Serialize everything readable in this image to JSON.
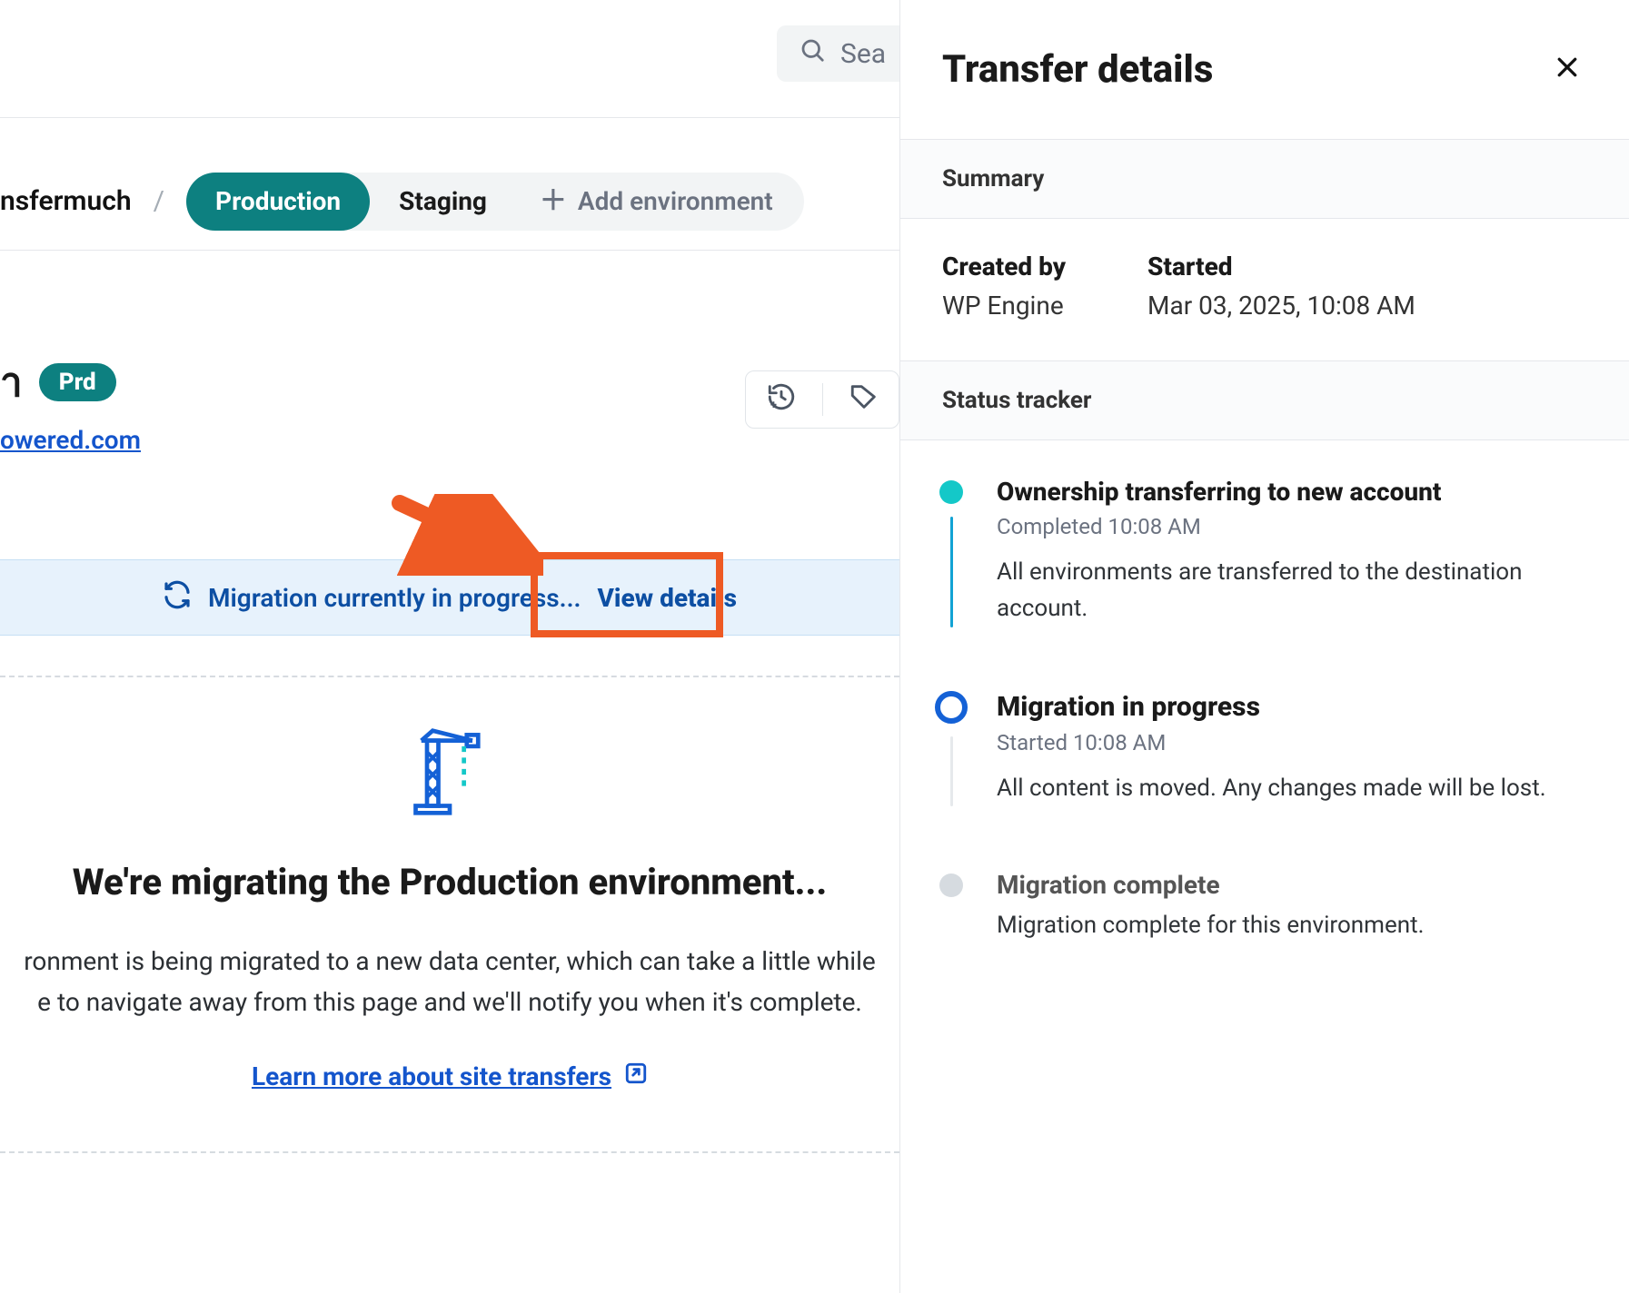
{
  "search": {
    "placeholder": "Sea"
  },
  "breadcrumb": {
    "site_fragment": "nsfermuch",
    "slash": "/"
  },
  "envs": {
    "production": "Production",
    "staging": "Staging",
    "add_label": "Add environment"
  },
  "header": {
    "name_fragment": "า",
    "prd_badge": "Prd",
    "domain_fragment": "owered.com"
  },
  "banner": {
    "message": "Migration currently in progress...",
    "cta": "View details"
  },
  "migration_card": {
    "title": "We're migrating the Production environment...",
    "body_line1": "ronment is being migrated to a new data center, which can take a little while",
    "body_line2": "e to navigate away from this page and we'll notify you when it's complete.",
    "learn_more": "Learn more about site transfers"
  },
  "panel": {
    "title": "Transfer details",
    "summary_label": "Summary",
    "created_by_label": "Created by",
    "created_by_value": "WP Engine",
    "started_label": "Started",
    "started_value": "Mar 03, 2025, 10:08 AM",
    "status_tracker_label": "Status tracker",
    "steps": [
      {
        "title": "Ownership transferring to new account",
        "substatus": "Completed 10:08 AM",
        "desc": "All environments are transferred to the destination account."
      },
      {
        "title": "Migration in progress",
        "substatus": "Started 10:08 AM",
        "desc": "All content is moved. Any changes made will be lost."
      },
      {
        "title": "Migration complete",
        "substatus": "",
        "desc": "Migration complete for this environment."
      }
    ]
  }
}
